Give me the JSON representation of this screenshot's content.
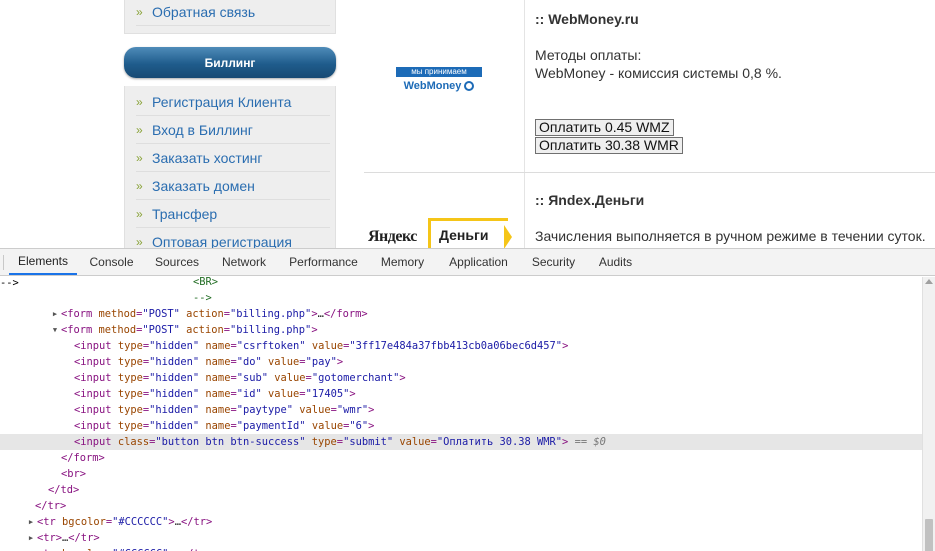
{
  "sidebar": {
    "top_item": "Обратная связь",
    "billing_header": "Биллинг",
    "billing_items": [
      "Регистрация Клиента",
      "Вход в Биллинг",
      "Заказать хостинг",
      "Заказать домен",
      "Трансфер",
      "Оптовая регистрация"
    ],
    "bullet": "»"
  },
  "payments": {
    "webmoney": {
      "title": ":: WebMoney.ru",
      "methods_label": "Методы оплаты:",
      "methods_text": "WebMoney - комиссия системы 0,8 %.",
      "logo_top": "мы принимаем",
      "logo_bottom": "WebMoney",
      "buttons": [
        "Оплатить 0.45 WMZ",
        "Оплатить 30.38 WMR"
      ]
    },
    "yandex": {
      "title": ":: Яndex.Деньги",
      "note": "Зачисления выполняется в ручном режиме в течении суток.",
      "logo_ya": "Яндекс",
      "logo_dengi": "Деньги"
    }
  },
  "devtools": {
    "tabs": [
      "Elements",
      "Console",
      "Sources",
      "Network",
      "Performance",
      "Memory",
      "Application",
      "Security",
      "Audits"
    ],
    "active_tab": "Elements",
    "selected_marker": "== $0",
    "colors": {
      "tag": "#881280",
      "attr_name": "#994500",
      "attr_value": "#1a1aa6",
      "selection": "#e6e6e6",
      "active_tab_underline": "#1a73e8"
    }
  }
}
